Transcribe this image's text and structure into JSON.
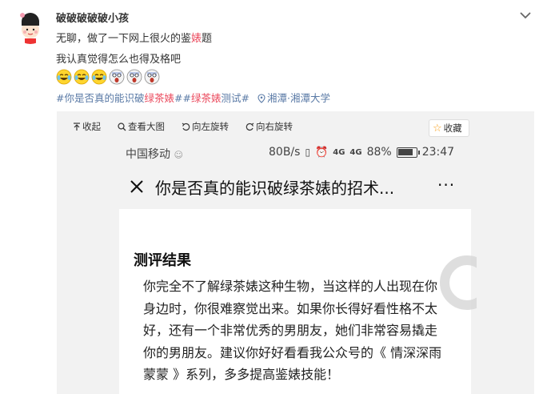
{
  "post": {
    "username": "破破破破破小孩",
    "line1_pre": "无聊，做了一下网上很火的鉴",
    "line1_red": "婊",
    "line1_post": "题",
    "line2": "我认真觉得怎么也得及格吧",
    "emojis": [
      "laugh-cry-emoji",
      "laugh-cry-emoji",
      "laugh-cry-emoji",
      "shocked-emoji",
      "shocked-emoji",
      "shocked-emoji"
    ],
    "tag1_pre": "#你是否真的能识破",
    "tag1_red": "绿茶婊",
    "tag1_post": "#",
    "tag2_pre": "#",
    "tag2_red": "绿茶婊",
    "tag2_mid": "测试",
    "tag2_post": "#",
    "location": "湘潭·湘潭大学",
    "link_color": "#5a7aa6",
    "highlight_color": "#eb4b5e"
  },
  "image_toolbar": {
    "collapse": "收起",
    "view_large": "查看大图",
    "rotate_left": "向左旋转",
    "rotate_right": "向右旋转",
    "favorite": "收藏"
  },
  "phone": {
    "carrier": "中国移动",
    "speed": "80B/s",
    "network": "4G",
    "network2": "4G",
    "battery": "88%",
    "time": "23:47",
    "page_title": "你是否真的能识破绿茶婊的招术...",
    "more": "···"
  },
  "result": {
    "title": "测评结果",
    "lines": [
      "你完全不了解绿茶婊这种生物，当这样的人出现在你",
      "身边时，你很难察觉出来。如果你长得好看性格不太",
      "好，还有一个非常优秀的男朋友，她们非常容易撬走",
      "你的男朋友。建议你好好看看我公众号的《 情深深雨",
      "蒙蒙 》系列，多多提高鉴婊技能！"
    ]
  }
}
